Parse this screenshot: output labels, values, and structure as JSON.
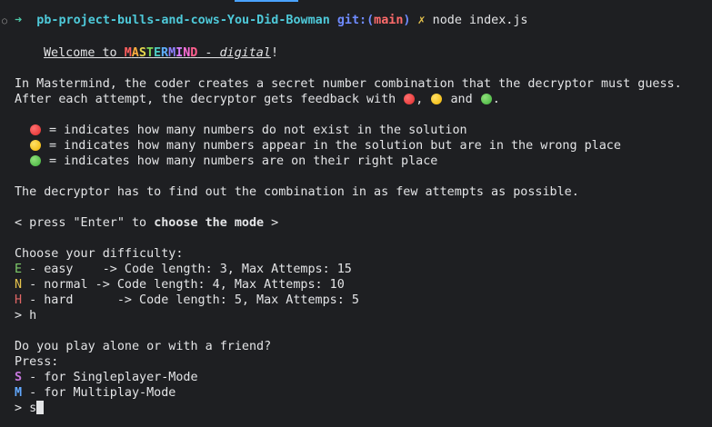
{
  "prompt": {
    "indicator": "○",
    "arrow": "➜",
    "cwd": "pb-project-bulls-and-cows-You-Did-Bowman",
    "git_label": "git:(",
    "branch": "main",
    "git_close": ")",
    "dirty_mark": "✗",
    "command": "node index.js"
  },
  "welcome": {
    "prefix": "Welcome to ",
    "brand_letters": [
      "M",
      "A",
      "S",
      "T",
      "E",
      "R",
      "M",
      "I",
      "N",
      "D"
    ],
    "brand_colors": [
      "#ff5f5f",
      "#ffaf3f",
      "#e6d84d",
      "#7ed957",
      "#4ecdc4",
      "#5fafff",
      "#8f7fff",
      "#d77fff",
      "#ff6fd8",
      "#ff5f8f"
    ],
    "dash": " - ",
    "digital": "digital",
    "bang": "!"
  },
  "intro": {
    "line1": "In Mastermind, the coder creates a secret number combination that the decryptor must guess.",
    "line2_a": "After each attempt, the decryptor gets feedback with ",
    "line2_sep1": ", ",
    "line2_sep2": " and ",
    "line2_end": "."
  },
  "legend": {
    "red": " = indicates how many numbers do not exist in the solution",
    "yellow": " = indicates how many numbers appear in the solution but are in the wrong place",
    "green": " = indicates how many numbers are on their right place"
  },
  "goal": "The decryptor has to find out the combination in as few attempts as possible.",
  "press": {
    "a": "< press \"Enter\" to ",
    "bold": "choose the mode",
    "b": " >"
  },
  "difficulty": {
    "title": "Choose your difficulty:",
    "easy_key": "E",
    "easy_text": " - easy    -> Code length: 3, Max Attemps: 15",
    "normal_key": "N",
    "normal_text": " - normal -> Code length: 4, Max Attemps: 10",
    "hard_key": "H",
    "hard_text": " - hard      -> Code length: 5, Max Attemps: 5",
    "answer": "> h"
  },
  "mode": {
    "question": "Do you play alone or with a friend?",
    "press": "Press:",
    "single_key": "S",
    "single_text": " - for Singleplayer-Mode",
    "multi_key": "M",
    "multi_text": " - for Multiplay-Mode",
    "input_prefix": "> ",
    "input_value": "s"
  }
}
